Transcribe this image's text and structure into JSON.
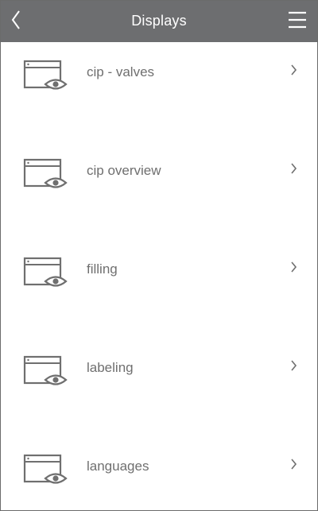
{
  "header": {
    "title": "Displays",
    "colors": {
      "background": "#6d6e70",
      "text": "#ffffff"
    },
    "back_icon": "chevron-left-icon",
    "menu_icon": "hamburger-menu-icon"
  },
  "list": {
    "items": [
      {
        "label": "cip - valves",
        "icon": "display-view-icon"
      },
      {
        "label": "cip overview",
        "icon": "display-view-icon"
      },
      {
        "label": "filling",
        "icon": "display-view-icon"
      },
      {
        "label": "labeling",
        "icon": "display-view-icon"
      },
      {
        "label": "languages",
        "icon": "display-view-icon"
      }
    ],
    "label_color": "#6f6f6f",
    "icon_color": "#6f6f6f"
  }
}
